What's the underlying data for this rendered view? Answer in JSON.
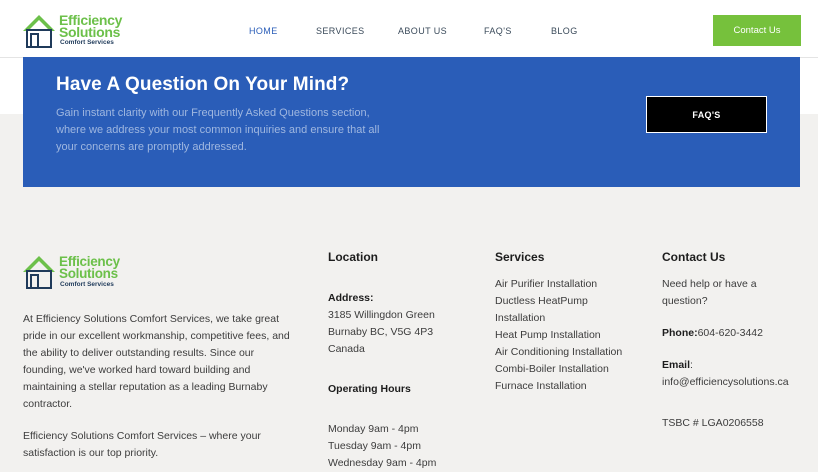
{
  "logo": {
    "line1": "Efficiency",
    "line2": "Solutions",
    "tagline": "Comfort Services",
    "colors": {
      "green": "#6cc04a",
      "navy": "#1f3a5a"
    }
  },
  "nav": {
    "items": [
      {
        "label": "HOME",
        "active": true
      },
      {
        "label": "SERVICES",
        "active": false
      },
      {
        "label": "ABOUT US",
        "active": false
      },
      {
        "label": "FAQ'S",
        "active": false
      },
      {
        "label": "BLOG",
        "active": false
      }
    ],
    "contact_button": "Contact Us"
  },
  "banner": {
    "title": "Have A Question On Your Mind?",
    "lines": [
      "Gain instant clarity with our Frequently Asked Questions section,",
      "where we address your most common inquiries and ensure that all",
      "your concerns are promptly addressed."
    ],
    "button": "FAQ'S",
    "color": "#2a5db8"
  },
  "footer": {
    "about": {
      "paragraph1": [
        "At Efficiency Solutions Comfort Services, we take great",
        "pride in our excellent workmanship, competitive fees, and",
        "the ability to deliver outstanding results. Since our",
        "founding, we've worked hard toward building and",
        "maintaining a stellar reputation as a leading Burnaby",
        "contractor."
      ],
      "paragraph2": [
        "Efficiency Solutions Comfort Services – where your",
        "satisfaction is our top priority."
      ]
    },
    "location": {
      "title": "Location",
      "address_label": "Address:",
      "address_lines": [
        "3185 Willingdon Green",
        "Burnaby BC, V5G 4P3",
        "Canada"
      ],
      "hours_title": "Operating Hours",
      "hours": [
        "Monday 9am - 4pm",
        "Tuesday 9am - 4pm",
        "Wednesday 9am - 4pm"
      ]
    },
    "services": {
      "title": "Services",
      "items": [
        "Air Purifier Installation",
        "Ductless HeatPump",
        "Installation",
        "Heat Pump Installation",
        "Air Conditioning Installation",
        "Combi-Boiler Installation",
        "Furnace Installation"
      ]
    },
    "contact": {
      "title": "Contact Us",
      "help_lines": [
        "Need help or have a",
        "question?"
      ],
      "phone_label": "Phone:",
      "phone": "604-620-3442",
      "email_label": "Email",
      "email_colon": ":",
      "email": "info@efficiencysolutions.ca",
      "tsbc": "TSBC # LGA0206558"
    }
  }
}
